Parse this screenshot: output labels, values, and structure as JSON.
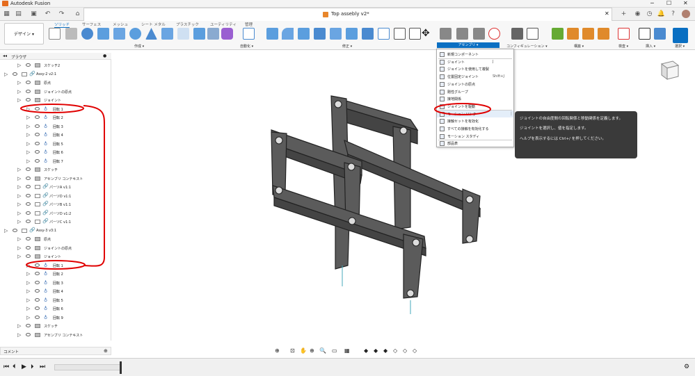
{
  "app": {
    "title": "Autodesk Fusion"
  },
  "document": {
    "title": "Top assebly v2*"
  },
  "workspace": {
    "label": "デザイン ▾"
  },
  "ws_tabs": [
    "ソリッド",
    "サーフェス",
    "メッシュ",
    "シート メタル",
    "プラスチック",
    "ユーティリティ",
    "管理"
  ],
  "groups": [
    "作成 ▾",
    "自動化 ▾",
    "修正 ▾",
    "アセンブリ ▾",
    "コンフィギュレーション ▾",
    "構築 ▾",
    "検査 ▾",
    "挿入 ▾",
    "選択 ▾"
  ],
  "browser": {
    "title": "ブラウザ",
    "rows": [
      "スケッチ2",
      "Assy-2 v2:1",
      "原点",
      "ジョイントの原点",
      "ジョイント",
      "回転 1",
      "回転 2",
      "回転 3",
      "回転 4",
      "回転 5",
      "回転 6",
      "回転 7",
      "スケッチ",
      "アセンブリ コンテキスト",
      "パーツA v1:1",
      "パーツD v1:1",
      "パーツB v1:1",
      "パーツD v1:2",
      "パーツC v1:1",
      "Assy-3 v3:1",
      "原点",
      "ジョイントの原点",
      "ジョイント",
      "回転 1",
      "回転 2",
      "回転 3",
      "回転 4",
      "回転 5",
      "回転 6",
      "回転 9",
      "スケッチ",
      "アセンブリ コンテキスト"
    ]
  },
  "comments": {
    "label": "コメント"
  },
  "menu": {
    "items": [
      {
        "label": "新規コンポーネント",
        "shortcut": ""
      },
      {
        "label": "ジョイント",
        "shortcut": "J"
      },
      {
        "label": "ジョイントを使用して複製",
        "shortcut": ""
      },
      {
        "label": "位置固定ジョイント",
        "shortcut": "Shift+J"
      },
      {
        "label": "ジョイントの原点",
        "shortcut": ""
      },
      {
        "label": "剛性グループ",
        "shortcut": ""
      },
      {
        "label": "接地関係",
        "shortcut": ""
      },
      {
        "label": "ジョイントを駆動",
        "shortcut": ""
      },
      {
        "label": "モーション リンク",
        "shortcut": ""
      },
      {
        "label": "接触セットを有効化",
        "shortcut": ""
      },
      {
        "label": "すべての接触を有効化する",
        "shortcut": ""
      },
      {
        "label": "モーション スタディ",
        "shortcut": ""
      },
      {
        "label": "部品表",
        "shortcut": ""
      }
    ]
  },
  "tooltip": {
    "line1": "ジョイントの自由度間の回転関係と移動関係を定義します。",
    "line2": "ジョイントを選択し、値を指定します。",
    "line3": "ヘルプを表示するには Ctrl+/ を押してください。"
  },
  "colors": {
    "accent": "#0a6fc2",
    "annotation": "#e00000",
    "part": "#5a5a5a"
  }
}
